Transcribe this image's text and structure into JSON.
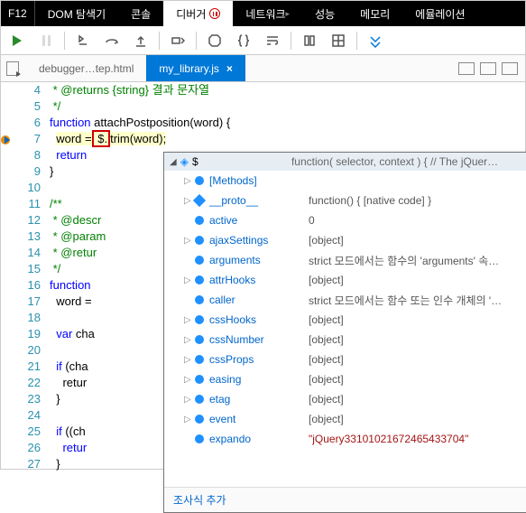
{
  "topbar": {
    "f12": "F12",
    "tabs": [
      "DOM 탐색기",
      "콘솔",
      "디버거",
      "네트워크",
      "성능",
      "메모리",
      "에뮬레이션"
    ],
    "activeIndex": 2
  },
  "filetabs": {
    "inactive": "debugger…tep.html",
    "active": "my_library.js",
    "close": "×"
  },
  "code": {
    "startLine": 4,
    "lines": [
      {
        "n": 4,
        "html": " * @returns {string} 결과 문자열",
        "cls": "c-comment"
      },
      {
        "n": 5,
        "html": " */",
        "cls": "c-comment"
      },
      {
        "n": 6,
        "html": "<span class='c-keyword'>function</span> attachPostposition(word) {"
      },
      {
        "n": 7,
        "html": "  <span class='c-hl'>word =</span><span class='c-box'> $.</span><span class='c-hl'>trim(word);</span>"
      },
      {
        "n": 8,
        "html": "  <span class='c-keyword'>return</span>"
      },
      {
        "n": 9,
        "html": "}"
      },
      {
        "n": 10,
        "html": ""
      },
      {
        "n": 11,
        "html": "/**",
        "cls": "c-comment"
      },
      {
        "n": 12,
        "html": " * @descr",
        "cls": "c-comment"
      },
      {
        "n": 13,
        "html": " * @param",
        "cls": "c-comment"
      },
      {
        "n": 14,
        "html": " * @retur",
        "cls": "c-comment"
      },
      {
        "n": 15,
        "html": " */",
        "cls": "c-comment"
      },
      {
        "n": 16,
        "html": "<span class='c-keyword'>function</span> "
      },
      {
        "n": 17,
        "html": "  word ="
      },
      {
        "n": 18,
        "html": ""
      },
      {
        "n": 19,
        "html": "  <span class='c-keyword'>var</span> cha"
      },
      {
        "n": 20,
        "html": ""
      },
      {
        "n": 21,
        "html": "  <span class='c-keyword'>if</span> (cha"
      },
      {
        "n": 22,
        "html": "    retur"
      },
      {
        "n": 23,
        "html": "  }"
      },
      {
        "n": 24,
        "html": ""
      },
      {
        "n": 25,
        "html": "  <span class='c-keyword'>if</span> ((ch"
      },
      {
        "n": 26,
        "html": "    <span class='c-keyword'>retur</span>"
      },
      {
        "n": 27,
        "html": "  }"
      }
    ]
  },
  "popup": {
    "header": {
      "name": "$",
      "value": "function( selector, context ) { // The jQuer…"
    },
    "rows": [
      {
        "exp": true,
        "shape": "dot",
        "name": "[Methods]",
        "value": ""
      },
      {
        "exp": true,
        "shape": "diamond",
        "name": "__proto__",
        "value": "function() { [native code] }"
      },
      {
        "exp": false,
        "shape": "dot",
        "name": "active",
        "value": "0"
      },
      {
        "exp": true,
        "shape": "dot",
        "name": "ajaxSettings",
        "value": "[object]"
      },
      {
        "exp": false,
        "shape": "dot",
        "name": "arguments",
        "value": "strict 모드에서는 함수의 'arguments' 속…"
      },
      {
        "exp": true,
        "shape": "dot",
        "name": "attrHooks",
        "value": "[object]"
      },
      {
        "exp": false,
        "shape": "dot",
        "name": "caller",
        "value": "strict 모드에서는 함수 또는 인수 개체의 '…"
      },
      {
        "exp": true,
        "shape": "dot",
        "name": "cssHooks",
        "value": "[object]"
      },
      {
        "exp": true,
        "shape": "dot",
        "name": "cssNumber",
        "value": "[object]"
      },
      {
        "exp": true,
        "shape": "dot",
        "name": "cssProps",
        "value": "[object]"
      },
      {
        "exp": true,
        "shape": "dot",
        "name": "easing",
        "value": "[object]"
      },
      {
        "exp": true,
        "shape": "dot",
        "name": "etag",
        "value": "[object]"
      },
      {
        "exp": true,
        "shape": "dot",
        "name": "event",
        "value": "[object]"
      },
      {
        "exp": false,
        "shape": "dot",
        "name": "expando",
        "value": "\"jQuery33101021672465433704\"",
        "str": true
      }
    ],
    "footer": "조사식 추가"
  }
}
